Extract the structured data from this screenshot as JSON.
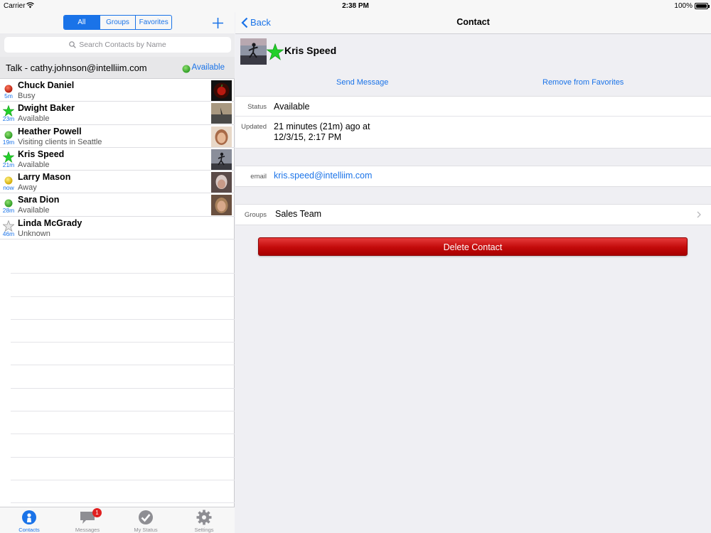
{
  "statusbar": {
    "carrier": "Carrier",
    "time": "2:38 PM",
    "battery": "100%"
  },
  "left": {
    "segments": [
      "All",
      "Groups",
      "Favorites"
    ],
    "active_segment": 0,
    "search_placeholder": "Search Contacts by Name",
    "talk": {
      "label": "Talk - cathy.johnson@intelliim.com",
      "status": "Available"
    },
    "contacts": [
      {
        "name": "Chuck Daniel",
        "status": "Busy",
        "time": "5m",
        "indicator": "red-dot",
        "photo_color": "#2a0a06"
      },
      {
        "name": "Dwight Baker",
        "status": "Available",
        "time": "23m",
        "indicator": "green-star",
        "photo_color": "#7a6a55"
      },
      {
        "name": "Heather Powell",
        "status": "Visiting clients in Seattle",
        "time": "19m",
        "indicator": "green-dot",
        "photo_color": "#c9a48a"
      },
      {
        "name": "Kris Speed",
        "status": "Available",
        "time": "21m",
        "indicator": "green-star",
        "photo_color": "#5a5a66"
      },
      {
        "name": "Larry Mason",
        "status": "Away",
        "time": "now",
        "indicator": "yellow-dot",
        "photo_color": "#8a7a78"
      },
      {
        "name": "Sara Dion",
        "status": "Available",
        "time": "28m",
        "indicator": "green-dot",
        "photo_color": "#a08068"
      },
      {
        "name": "Linda McGrady",
        "status": "Unknown",
        "time": "46m",
        "indicator": "grey-star",
        "photo_color": ""
      }
    ]
  },
  "tabbar": {
    "tabs": [
      {
        "label": "Contacts",
        "icon": "contact-icon",
        "active": true
      },
      {
        "label": "Messages",
        "icon": "messages-icon",
        "badge": "1"
      },
      {
        "label": "My Status",
        "icon": "checkmark-icon"
      },
      {
        "label": "Settings",
        "icon": "gear-icon"
      }
    ]
  },
  "right": {
    "back_label": "Back",
    "title": "Contact",
    "contact_name": "Kris Speed",
    "actions": {
      "send_message": "Send Message",
      "remove_favorite": "Remove from Favorites"
    },
    "status": {
      "key": "Status",
      "value": "Available"
    },
    "updated": {
      "key": "Updated",
      "line1": "21 minutes (21m) ago at",
      "line2": "12/3/15, 2:17 PM"
    },
    "email": {
      "key": "email",
      "value": "kris.speed@intelliim.com"
    },
    "groups": {
      "key": "Groups",
      "value": "Sales Team"
    },
    "delete_label": "Delete Contact"
  },
  "colors": {
    "accent": "#1a73e8",
    "delete": "#c20a0a",
    "available": "#3ab03a",
    "busy": "#cc2a1a",
    "away": "#e0c020"
  }
}
